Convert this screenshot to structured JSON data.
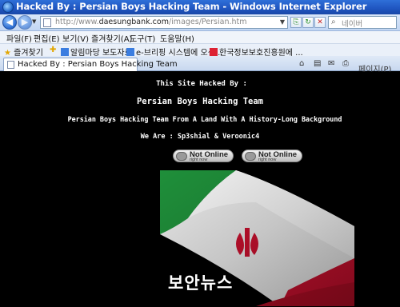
{
  "window": {
    "title": "Hacked By : Persian Boys Hacking Team - Windows Internet Explorer"
  },
  "address_bar": {
    "url_prefix": "http://www.",
    "url_domain": "daesungbank.com",
    "url_path": "/images/Persian.htm",
    "search_placeholder": "네이버"
  },
  "menu": {
    "items": [
      "파일(F)",
      "편집(E)",
      "보기(V)",
      "즐겨찾기(A)",
      "도구(T)",
      "도움말(H)"
    ]
  },
  "favorites_bar": {
    "favorites_label": "즐겨찾기",
    "items": [
      "알림마당 보도자료",
      "e-브리핑 시스템에 오신...",
      "한국정보보호진흥원에 ..."
    ]
  },
  "tab": {
    "label": "Hacked By : Persian Boys Hacking Team"
  },
  "tab_tools": {
    "page_label": "페이지(P)"
  },
  "content": {
    "hacked_line": "This Site Hacked By :",
    "team_name": "Persian Boys Hacking Team",
    "slogan": "Persian Boys Hacking Team From A Land With A History-Long Background",
    "we_are": "We Are : Sp3shial & Veroonic4",
    "status_badges": [
      {
        "title": "Not Online",
        "subtitle": "right now"
      },
      {
        "title": "Not Online",
        "subtitle": "right now"
      }
    ],
    "watermark": "보안뉴스"
  },
  "colors": {
    "titlebar": "#1f55c0",
    "page_background": "#000000",
    "text": "#ffffff",
    "flag_green": "#239f40",
    "flag_white": "#ffffff",
    "flag_red": "#da0000"
  }
}
